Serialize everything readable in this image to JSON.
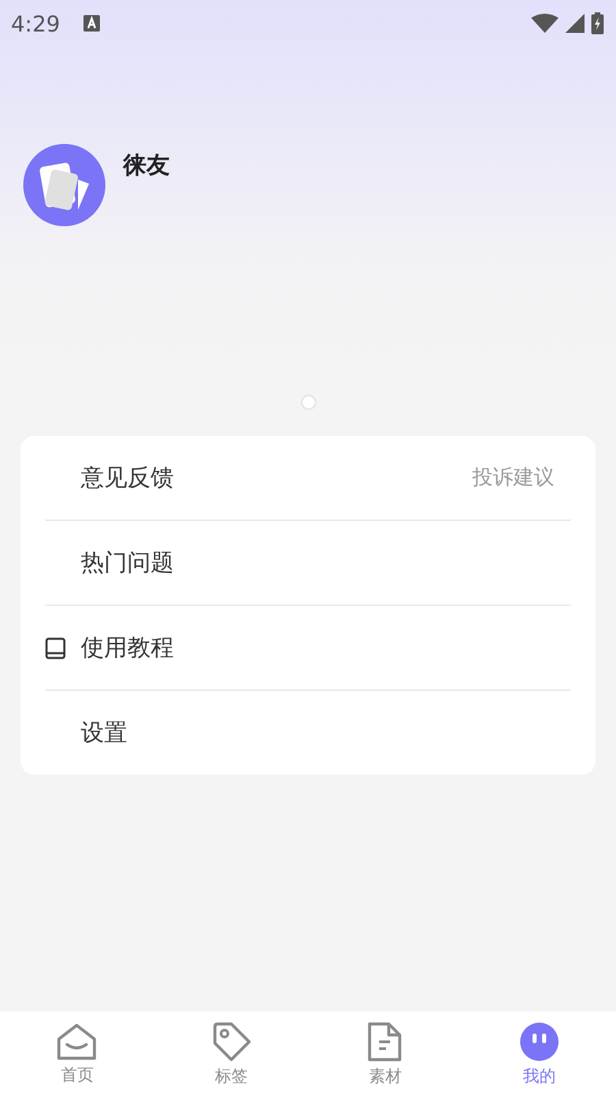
{
  "status_bar": {
    "time": "4:29"
  },
  "profile": {
    "name": "徕友"
  },
  "pager": [
    {
      "selected": true
    }
  ],
  "menu": [
    {
      "label": "意见反馈",
      "hint": "投诉建议",
      "has_icon": false
    },
    {
      "label": "热门问题",
      "has_icon": false
    },
    {
      "label": "使用教程",
      "has_icon": true
    },
    {
      "label": "设置",
      "has_icon": false
    }
  ],
  "tabs": [
    {
      "label": "首页",
      "kind": "home",
      "selected": false
    },
    {
      "label": "标签",
      "kind": "tag",
      "selected": false
    },
    {
      "label": "素材",
      "kind": "file",
      "selected": false
    },
    {
      "label": "我的",
      "kind": "profile",
      "selected": true
    }
  ]
}
